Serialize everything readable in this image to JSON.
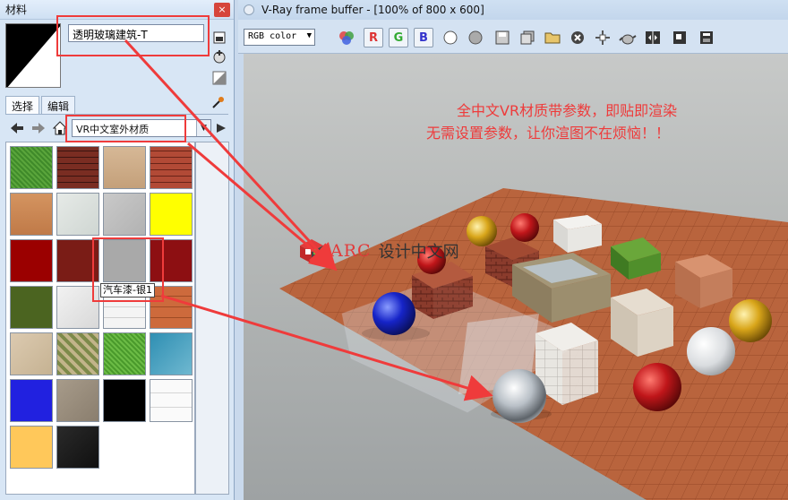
{
  "material_panel": {
    "title": "材料",
    "close": "×",
    "material_name": "透明玻璃建筑-T",
    "tabs": [
      "选择",
      "编辑"
    ],
    "library": "VR中文室外材质",
    "tooltip": "汽车漆-银1",
    "swatch_icons": [
      "grass",
      "brick",
      "sandstone",
      "red-brick",
      "terracotta",
      "marble-white",
      "concrete",
      "yellow",
      "dark-red",
      "maroon",
      "grey-paint",
      "crimson",
      "olive",
      "white-marble",
      "white-tile",
      "orange-tile",
      "beige-stone",
      "mosaic",
      "green-grass",
      "water",
      "blue",
      "granite",
      "black",
      "white-grid",
      "light-orange",
      "black-granite"
    ]
  },
  "vfb": {
    "title": "V-Ray frame buffer - [100% of 800 x 600]",
    "channel": "RGB color",
    "channels": [
      "R",
      "G",
      "B"
    ]
  },
  "captions": {
    "line1": "全中文VR材质带参数，即贴即渲染",
    "line2": "无需设置参数，让你渲图不在烦恼！！",
    "brand": "ARC",
    "brand_suffix": "设计中文网"
  },
  "colors": {
    "annotation": "#ef3b3b",
    "panel_bg": "#d8e6f5"
  }
}
